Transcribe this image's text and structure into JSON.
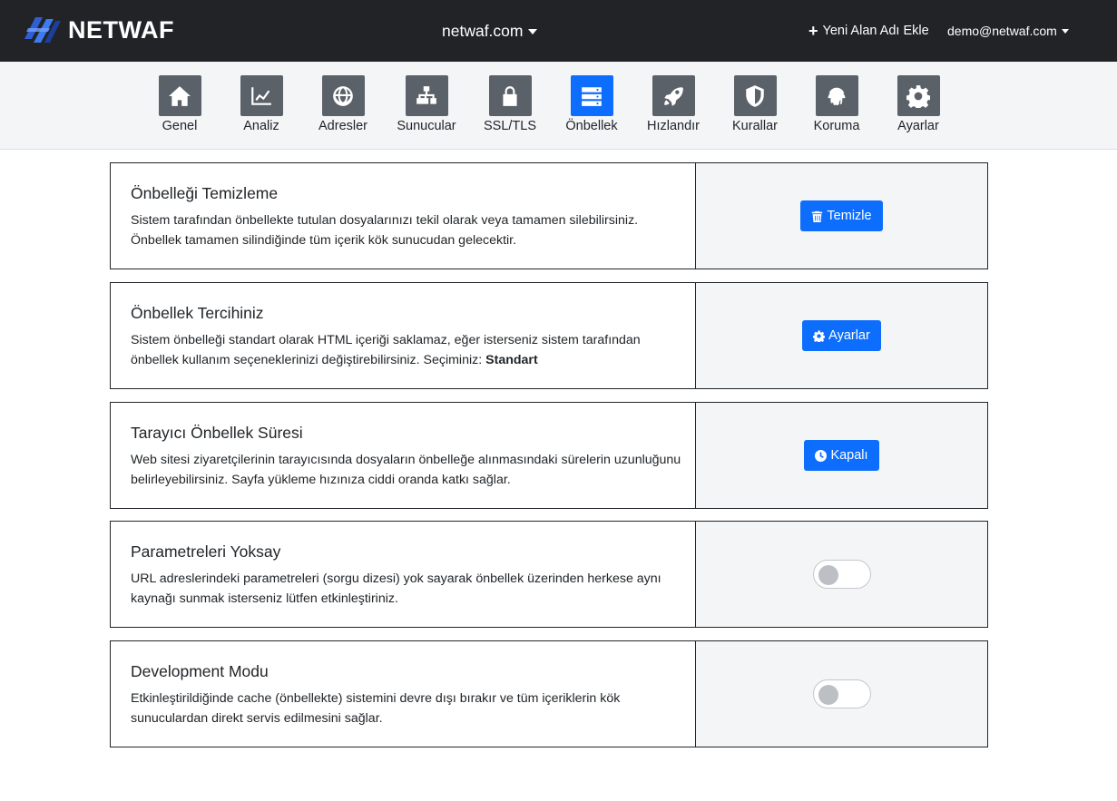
{
  "header": {
    "logo_text": "NETWAF",
    "logo_icon": "netwaf-logo-icon",
    "domain": "netwaf.com",
    "add_domain_label": "Yeni Alan Adı Ekle",
    "user_email": "demo@netwaf.com"
  },
  "nav": {
    "active": "Önbellek",
    "items": [
      {
        "label": "Genel",
        "icon": "home-icon"
      },
      {
        "label": "Analiz",
        "icon": "chart-line-icon"
      },
      {
        "label": "Adresler",
        "icon": "globe-icon"
      },
      {
        "label": "Sunucular",
        "icon": "network-icon"
      },
      {
        "label": "SSL/TLS",
        "icon": "lock-icon"
      },
      {
        "label": "Önbellek",
        "icon": "server-icon"
      },
      {
        "label": "Hızlandır",
        "icon": "rocket-icon"
      },
      {
        "label": "Kurallar",
        "icon": "shield-icon"
      },
      {
        "label": "Koruma",
        "icon": "fingerprint-icon"
      },
      {
        "label": "Ayarlar",
        "icon": "gear-icon"
      }
    ]
  },
  "cards": [
    {
      "title": "Önbelleği Temizleme",
      "desc": "Sistem tarafından önbellekte tutulan dosyalarınızı tekil olarak veya tamamen silebilirsiniz. Önbellek tamamen silindiğinde tüm içerik kök sunucudan gelecektir.",
      "button_label": "Temizle",
      "button_icon": "trash-icon"
    },
    {
      "title": "Önbellek Tercihiniz",
      "desc": "Sistem önbelleği standart olarak HTML içeriği saklamaz, eğer isterseniz sistem tarafından önbellek kullanım seçeneklerinizi değiştirebilirsiniz. Seçiminiz:",
      "selection": "Standart",
      "button_label": "Ayarlar",
      "button_icon": "gear-icon"
    },
    {
      "title": "Tarayıcı Önbellek Süresi",
      "desc": "Web sitesi ziyaretçilerinin tarayıcısında dosyaların önbelleğe alınmasındaki sürelerin uzunluğunu belirleyebilirsiniz. Sayfa yükleme hızınıza ciddi oranda katkı sağlar.",
      "button_label": "Kapalı",
      "button_icon": "clock-icon"
    },
    {
      "title": "Parametreleri Yoksay",
      "desc": "URL adreslerindeki parametreleri (sorgu dizesi) yok sayarak önbellek üzerinden herkese aynı kaynağı sunmak isterseniz lütfen etkinleştiriniz.",
      "toggle_on": false
    },
    {
      "title": "Development Modu",
      "desc": "Etkinleştirildiğinde cache (önbellekte) sistemini devre dışı bırakır ve tüm içeriklerin kök sunuculardan direkt servis edilmesini sağlar.",
      "toggle_on": false
    }
  ],
  "colors": {
    "topbar": "#212327",
    "accent": "#0d6efd",
    "nav_tile": "#5b6168",
    "panel_bg": "#f4f5f7"
  }
}
